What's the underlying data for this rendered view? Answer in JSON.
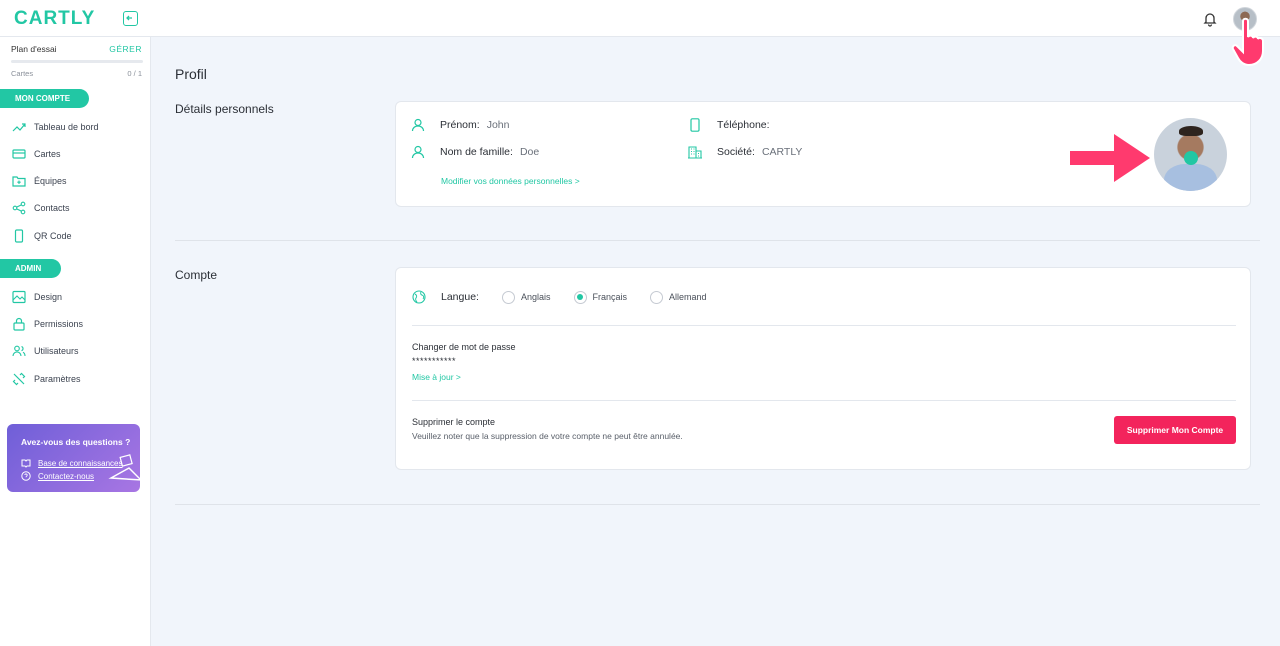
{
  "brand": {
    "name": "CARTLY",
    "accent": "#22c7a4",
    "danger": "#f3245c"
  },
  "sidebar": {
    "plan": {
      "label": "Plan d'essai",
      "manage": "GÉRER"
    },
    "usage": {
      "label": "Cartes",
      "count": "0 / 1",
      "fraction": 0
    },
    "sections": [
      {
        "title": "MON COMPTE",
        "items": [
          {
            "label": "Tableau de bord",
            "icon": "trending-up-icon"
          },
          {
            "label": "Cartes",
            "icon": "card-icon"
          },
          {
            "label": "Équipes",
            "icon": "folder-plus-icon"
          },
          {
            "label": "Contacts",
            "icon": "share-icon"
          },
          {
            "label": "QR Code",
            "icon": "phone-icon"
          }
        ]
      },
      {
        "title": "ADMIN",
        "items": [
          {
            "label": "Design",
            "icon": "image-icon"
          },
          {
            "label": "Permissions",
            "icon": "lock-icon"
          },
          {
            "label": "Utilisateurs",
            "icon": "users-icon"
          },
          {
            "label": "Paramètres",
            "icon": "tools-icon"
          }
        ]
      }
    ],
    "help": {
      "title": "Avez-vous des questions ?",
      "links": [
        "Base de connaissances",
        "Contactez-nous"
      ]
    }
  },
  "main": {
    "title": "Profil",
    "personal": {
      "section_title": "Détails personnels",
      "first_name_label": "Prénom:",
      "first_name": "John",
      "last_name_label": "Nom de famille:",
      "last_name": "Doe",
      "phone_label": "Téléphone:",
      "phone": "",
      "company_label": "Société:",
      "company": "CARTLY",
      "edit_link": "Modifier vos données personnelles >"
    },
    "account": {
      "section_title": "Compte",
      "language_label": "Langue:",
      "languages": [
        "Anglais",
        "Français",
        "Allemand"
      ],
      "selected_language": "Français",
      "password_title": "Changer de mot de passe",
      "password_mask": "***********",
      "password_link": "Mise à jour >",
      "delete_title": "Supprimer le compte",
      "delete_desc": "Veuillez noter que la suppression de votre compte ne peut être annulée.",
      "delete_button": "Supprimer Mon Compte"
    }
  }
}
